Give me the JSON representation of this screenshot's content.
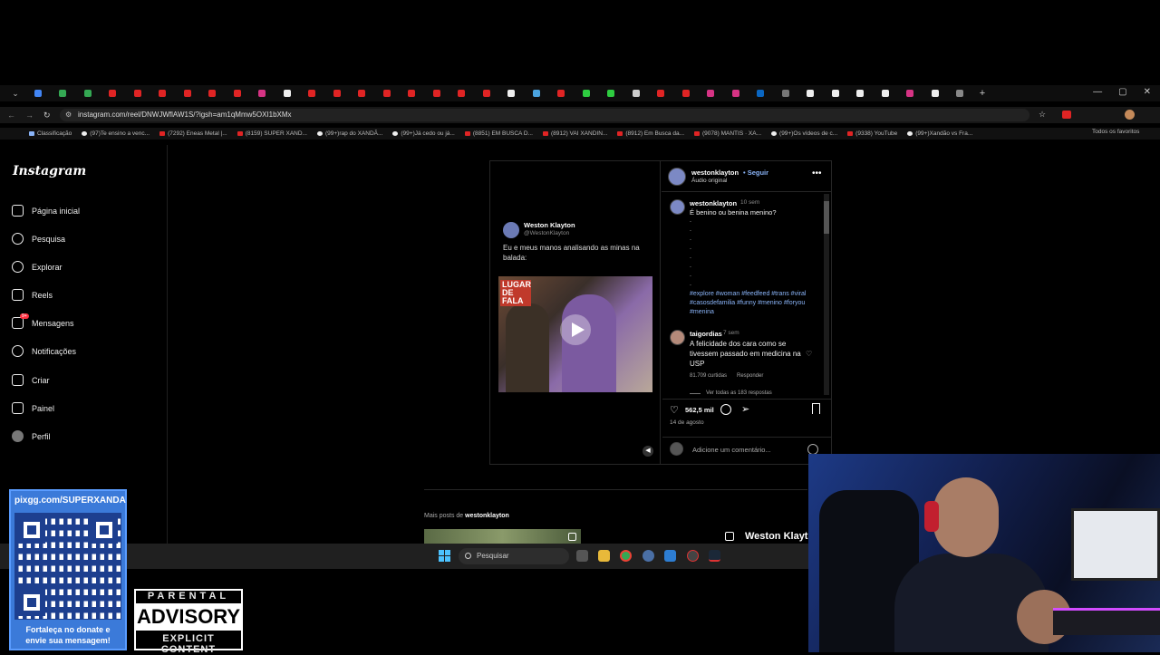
{
  "browser": {
    "address": "instagram.com/reel/DNWJWflAW1S/?igsh=am1qMmw5OXI1bXMx",
    "bookmarks": [
      {
        "label": "Classificação",
        "kind": "gr"
      },
      {
        "label": "(97)Te ensino a venc...",
        "kind": "tk"
      },
      {
        "label": "(7292) Eneas Metal |...",
        "kind": "yt"
      },
      {
        "label": "(8159) SUPER XAND...",
        "kind": "yt"
      },
      {
        "label": "(99+)rap do XANDÃ...",
        "kind": "tk"
      },
      {
        "label": "(99+)Já cedo ou já...",
        "kind": "tk"
      },
      {
        "label": "(8851) EM BUSCA D...",
        "kind": "yt"
      },
      {
        "label": "(8912) VAI XANDIN...",
        "kind": "yt"
      },
      {
        "label": "(8912) Em Busca da...",
        "kind": "yt"
      },
      {
        "label": "(9078) MANTIS · XA...",
        "kind": "yt"
      },
      {
        "label": "(99+)Os vídeos de c...",
        "kind": "tk"
      },
      {
        "label": "(9338) YouTube",
        "kind": "yt"
      },
      {
        "label": "(99+)Xandão vs Fra...",
        "kind": "tk"
      }
    ],
    "all_favorites": "Todos os favoritos"
  },
  "sidebar": {
    "logo": "Instagram",
    "items": [
      {
        "label": "Página inicial",
        "icon": "home-icon"
      },
      {
        "label": "Pesquisa",
        "icon": "search-icon"
      },
      {
        "label": "Explorar",
        "icon": "compass-icon"
      },
      {
        "label": "Reels",
        "icon": "reels-icon"
      },
      {
        "label": "Mensagens",
        "icon": "messenger-icon",
        "badge": "9+"
      },
      {
        "label": "Notificações",
        "icon": "heart-icon"
      },
      {
        "label": "Criar",
        "icon": "plus-icon"
      },
      {
        "label": "Painel",
        "icon": "dashboard-icon"
      },
      {
        "label": "Perfil",
        "icon": "profile-avatar"
      }
    ]
  },
  "post": {
    "tweet": {
      "name": "Weston Klayton",
      "handle": "@WestonKlayton",
      "text": "Eu e meus manos analisando as minas na balada:",
      "video_label": "LUGAR DE FALA"
    },
    "header": {
      "username": "westonklayton",
      "follow": "• Seguir",
      "audio": "Áudio original",
      "more": "•••"
    },
    "caption": {
      "author": "westonklayton",
      "time": "10 sem",
      "text": "É benino ou benina menino?",
      "dots": [
        ".",
        ".",
        ".",
        ".",
        ".",
        ".",
        ".",
        "."
      ],
      "tags": "#explore #woman #feedfeed #trans #viral #casosdefamilia #funny #menino #foryou #menina"
    },
    "reply": {
      "author": "taigordias",
      "time": "7 sem",
      "text": "A felicidade dos cara como se tivessem passado em medicina na USP",
      "likes": "81.709 curtidas",
      "reply": "Responder",
      "view_replies": "Ver todas as 183 respostas"
    },
    "likes": "562,5 mil",
    "date": "14 de agosto",
    "add_comment_placeholder": "Adicione um comentário..."
  },
  "more_posts": {
    "prefix": "Mais posts de ",
    "user": "westonklayton",
    "overlay_name": "Weston Klayto"
  },
  "taskbar": {
    "search": "Pesquisar"
  },
  "overlay": {
    "qr_url": "pixgg.com/SUPERXANDA",
    "qr_text": "Fortaleça no donate e envie sua mensagem!",
    "parental_1": "PARENTAL",
    "parental_2": "ADVISORY",
    "parental_3": "EXPLICIT CONTENT"
  }
}
